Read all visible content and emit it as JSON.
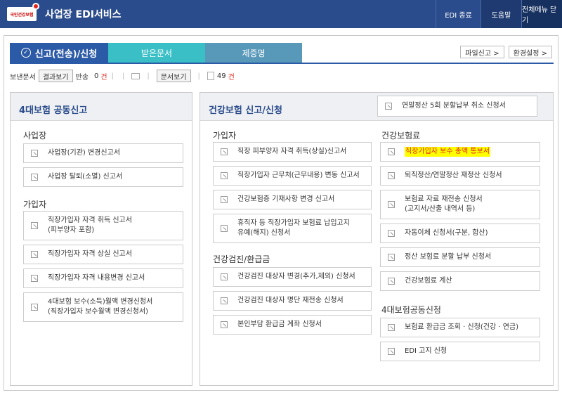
{
  "header": {
    "logo_text": "국민건강보험",
    "title": "사업장 EDI서비스",
    "edi_end": "EDI 종료",
    "help": "도움말",
    "all_menu_close": "전체메뉴 닫기"
  },
  "tabs": {
    "send": "신고(전송)/신청",
    "received": "받은문서",
    "certificate": "제증명"
  },
  "top_buttons": {
    "file_report": "파일신고 >",
    "settings": "환경설정 >"
  },
  "status": {
    "sent_label": "보낸문서",
    "result_btn": "결과보기",
    "returned_label": "반송",
    "returned_count": "0",
    "unit": "건",
    "doc_btn": "문서보기",
    "doc_count": "49"
  },
  "left": {
    "title": "4대보험 공동신고",
    "sec_business": "사업장",
    "business_items": [
      "사업장(기관) 변경신고서",
      "사업장 탈퇴(소멸) 신고서"
    ],
    "sec_subscriber": "가입자",
    "subscriber_items": [
      [
        "직장가입자 자격 취득 신고서",
        "(피부양자 포함)"
      ],
      [
        "직장가입자 자격 상실 신고서"
      ],
      [
        "직장가입자 자격 내용변경 신고서"
      ],
      [
        "4대보험 보수(소득)월액 변경신청서",
        "(직장가입자 보수월액 변경신청서)"
      ]
    ]
  },
  "right": {
    "title": "건강보험 신고/신청",
    "top_item": "연말정산 5회 분할납부 취소 신청서",
    "sec_subscriber": "가입자",
    "subscriber_items": [
      [
        "직장 피부양자 자격 취득(상실)신고서"
      ],
      [
        "직장가입자 근무처(근무내용) 변동 신고서"
      ],
      [
        "건강보험증 기재사항 변경 신고서"
      ],
      [
        "휴직자 등 직장가입자 보험료 납입고지",
        "유예(해지) 신청서"
      ]
    ],
    "sec_checkup": "건강검진/환급금",
    "checkup_items": [
      "건강검진 대상자 변경(추가,제외) 신청서",
      "건강검진 대상자 명단 재전송 신청서",
      "본인부담 환급금 계좌 신청서"
    ],
    "sec_premium": "건강보험료",
    "premium_items": [
      [
        "직장가입자 보수 총액 통보서"
      ],
      [
        "퇴직정산/연말정산 재정산 신청서"
      ],
      [
        "보험료 자료 재전송 신청서",
        "(고지서/산출 내역서 등)"
      ],
      [
        "자동이체 신청서(구분, 합산)"
      ],
      [
        "정산 보험료 분할 납부 신청서"
      ],
      [
        "건강보험료 계산"
      ]
    ],
    "sec_joint": "4대보험공동신청",
    "joint_items": [
      "보험료 환급금 조회 · 신청(건강 · 연금)",
      "EDI 고지 신청"
    ]
  }
}
